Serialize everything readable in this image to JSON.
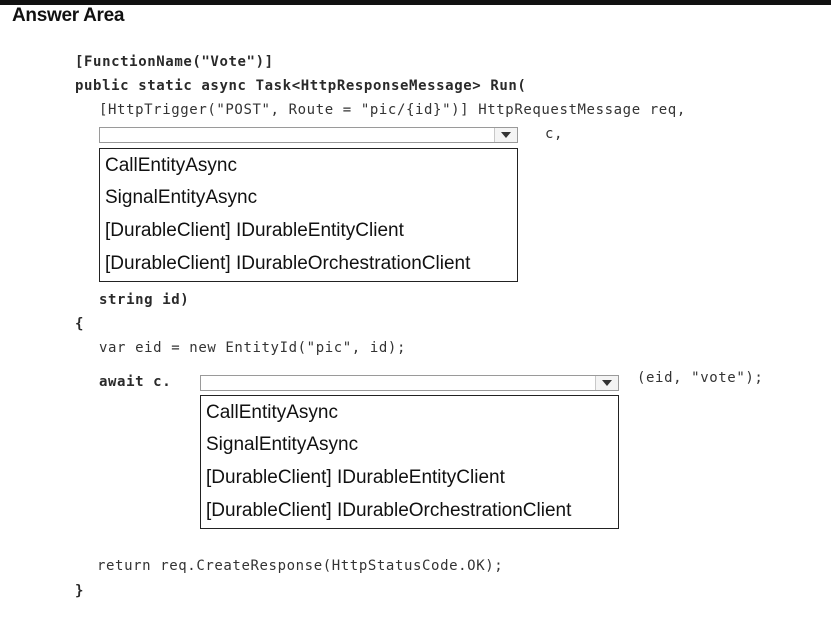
{
  "header": {
    "title": "Answer Area"
  },
  "code": {
    "line1": "[FunctionName(\"Vote\")]",
    "line2": "public static async Task<HttpResponseMessage> Run(",
    "line3": "[HttpTrigger(\"POST\", Route = \"pic/{id}\")] HttpRequestMessage req,",
    "line4_suffix": "c,",
    "line5": "string id)",
    "line6": "{",
    "line7": "var eid = new EntityId(\"pic\", id);",
    "line8_prefix": "await c.",
    "line8_suffix": "(eid, \"vote\");",
    "line9": "return req.CreateResponse(HttpStatusCode.OK);",
    "line10": "}"
  },
  "dropdown1": {
    "selected": "",
    "options": [
      "CallEntityAsync",
      "SignalEntityAsync",
      "[DurableClient] IDurableEntityClient",
      "[DurableClient] IDurableOrchestrationClient"
    ]
  },
  "dropdown2": {
    "selected": "",
    "options": [
      "CallEntityAsync",
      "SignalEntityAsync",
      "[DurableClient] IDurableEntityClient",
      "[DurableClient] IDurableOrchestrationClient"
    ]
  }
}
